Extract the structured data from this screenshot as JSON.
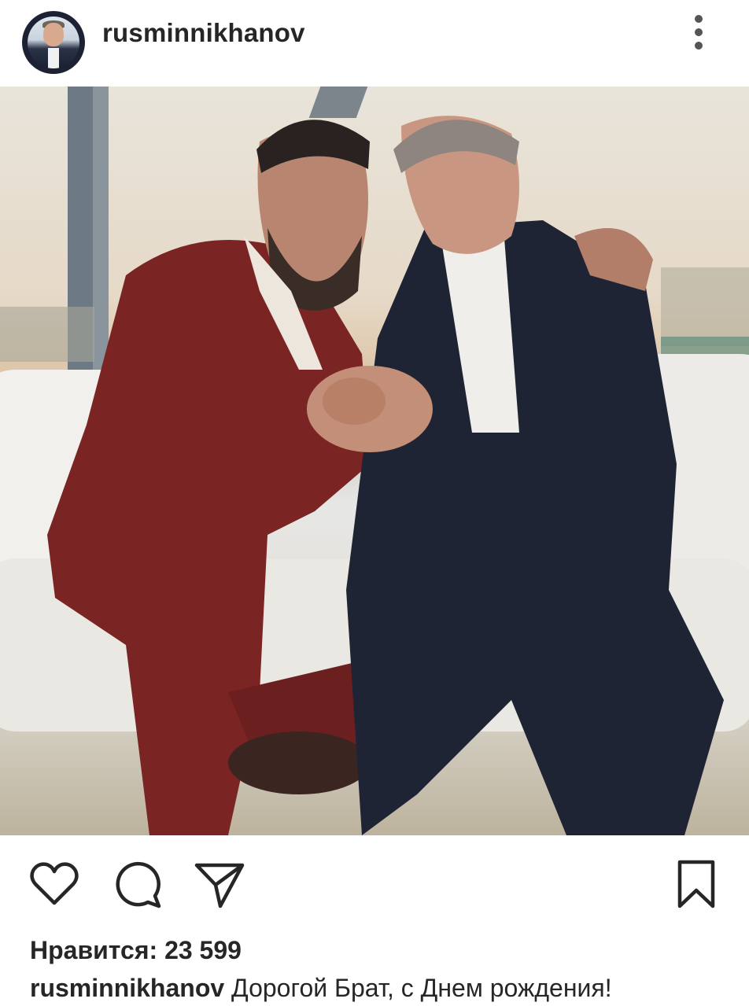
{
  "header": {
    "username": "rusminnikhanov",
    "avatar_icon": "profile-avatar",
    "menu_icon": "more-vertical-icon"
  },
  "actions": {
    "like_icon": "heart-icon",
    "comment_icon": "comment-icon",
    "share_icon": "send-icon",
    "save_icon": "bookmark-icon"
  },
  "likes": {
    "label": "Нравится:",
    "count": "23 599"
  },
  "caption": {
    "username": "rusminnikhanov",
    "text": "Дорогой Брат, с Днем рождения!"
  },
  "colors": {
    "text": "#262626",
    "icon": "#262626",
    "avatar_ring": "#1c2233"
  }
}
